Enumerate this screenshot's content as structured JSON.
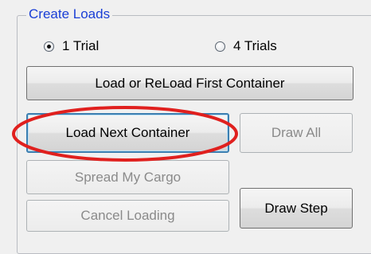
{
  "group": {
    "title": "Create Loads"
  },
  "radios": [
    {
      "label": "1 Trial",
      "checked": true
    },
    {
      "label": "4 Trials",
      "checked": false
    }
  ],
  "buttons": {
    "load_first": "Load or ReLoad First Container",
    "load_next": "Load Next Container",
    "draw_all": "Draw All",
    "spread_cargo": "Spread My Cargo",
    "cancel_loading": "Cancel Loading",
    "draw_step": "Draw Step"
  },
  "annotation_color": "#e0201e"
}
